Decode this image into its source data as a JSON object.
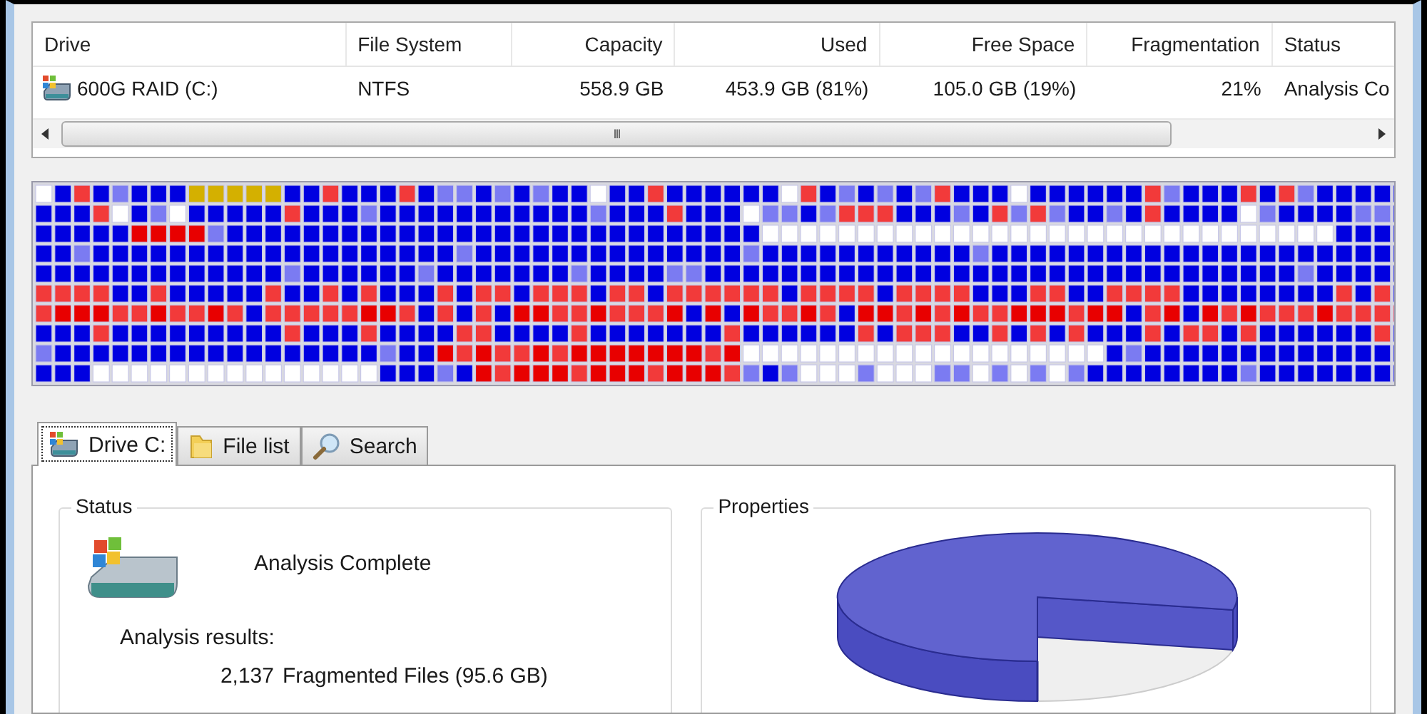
{
  "drive_list": {
    "columns": [
      {
        "label": "Drive"
      },
      {
        "label": "File System"
      },
      {
        "label": "Capacity"
      },
      {
        "label": "Used"
      },
      {
        "label": "Free Space"
      },
      {
        "label": "Fragmentation"
      },
      {
        "label": "Status"
      }
    ],
    "rows": [
      {
        "cells": [
          "600G RAID (C:)",
          "NTFS",
          "558.9 GB",
          "453.9 GB (81%)",
          "105.0 GB (19%)",
          "21%",
          "Analysis Co"
        ]
      }
    ],
    "scrollbar": {
      "grip": "III"
    }
  },
  "tabs": [
    {
      "label": "Drive C:",
      "kind": "drive",
      "selected": true
    },
    {
      "label": "File list",
      "kind": "folder",
      "selected": false
    },
    {
      "label": "Search",
      "kind": "search",
      "selected": false
    }
  ],
  "status_group": {
    "title": "Status",
    "message": "Analysis Complete",
    "results_heading": "Analysis results:",
    "results": [
      {
        "count": "2,137",
        "text": "Fragmented Files (95.6 GB)"
      }
    ]
  },
  "properties_group": {
    "title": "Properties"
  }
}
